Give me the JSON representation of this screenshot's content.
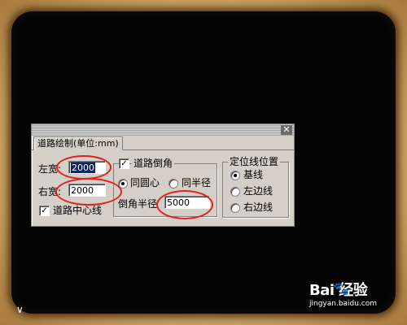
{
  "dialog": {
    "close_glyph": "✕",
    "tab_label": "道路绘制(单位:mm)",
    "left_width_label": "左宽:",
    "left_width_value": "2000",
    "right_width_label": "右宽:",
    "right_width_value": "2000",
    "centerline_label": "道路中心线",
    "centerline_checked": true,
    "chamfer": {
      "label": "道路倒角",
      "checked": true,
      "concentric_label": "同圆心",
      "same_radius_label": "同半径",
      "selected": "concentric",
      "radius_label": "倒角半径",
      "radius_value": "5000"
    },
    "position": {
      "title": "定位线位置",
      "options": [
        "基线",
        "左边线",
        "右边线"
      ],
      "selected": "基线"
    }
  },
  "watermark": {
    "brand": "Bai 经验",
    "paw_icon": "paw-icon",
    "url": "jingyan.baidu.com"
  },
  "colors": {
    "highlight_circle": "#e02020",
    "selection": "#0a246a",
    "dialog_bg": "#d4d0c8",
    "canvas_bg": "#050505"
  }
}
